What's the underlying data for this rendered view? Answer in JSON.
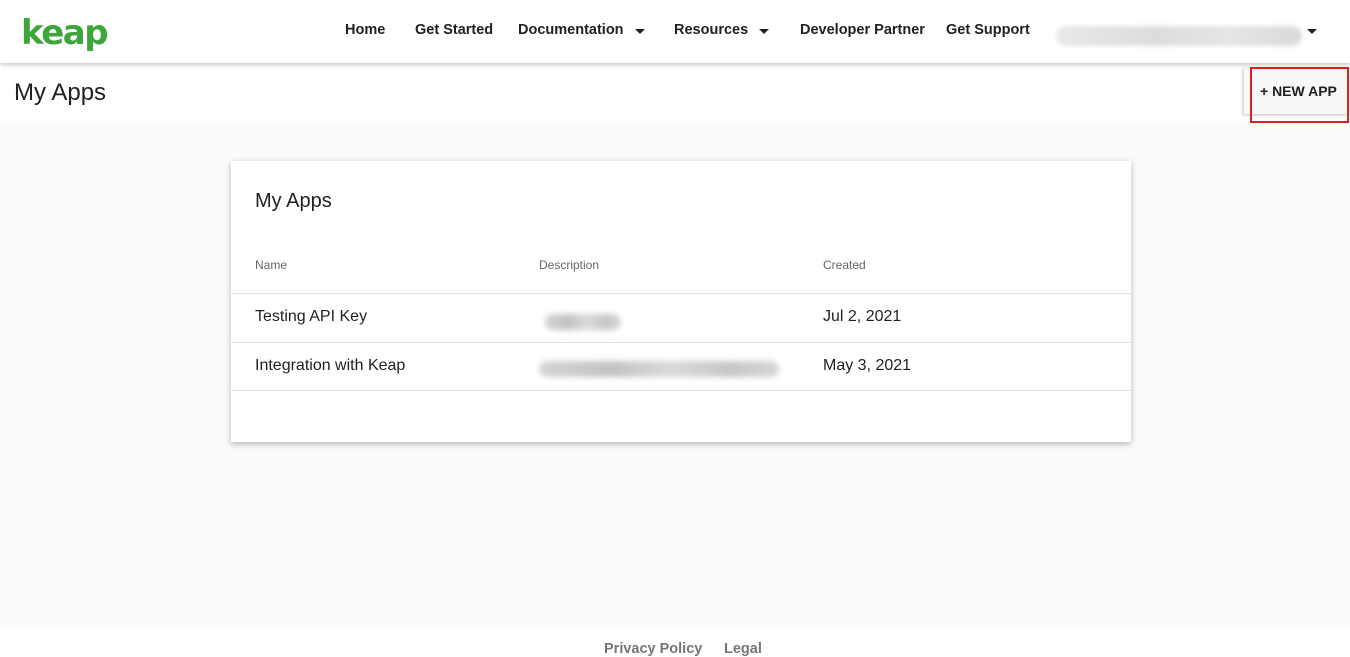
{
  "brand": {
    "logo_text": "keap",
    "accent_color": "#3da53a"
  },
  "nav": {
    "items": [
      {
        "label": "Home",
        "has_dropdown": false
      },
      {
        "label": "Get Started",
        "has_dropdown": false
      },
      {
        "label": "Documentation",
        "has_dropdown": true
      },
      {
        "label": "Resources",
        "has_dropdown": true
      },
      {
        "label": "Developer Partner",
        "has_dropdown": false
      },
      {
        "label": "Get Support",
        "has_dropdown": false
      }
    ],
    "account_icon": "chevron-down-icon"
  },
  "subheader": {
    "title": "My Apps",
    "new_app_label": "+ NEW APP",
    "highlight_color": "#e21c1c"
  },
  "apps_card": {
    "title": "My Apps",
    "columns": {
      "name": "Name",
      "description": "Description",
      "created": "Created"
    },
    "rows": [
      {
        "name": "Testing API Key",
        "created": "Jul 2, 2021"
      },
      {
        "name": "Integration with Keap",
        "created": "May 3, 2021"
      }
    ]
  },
  "footer": {
    "privacy_label": "Privacy Policy",
    "legal_label": "Legal"
  }
}
